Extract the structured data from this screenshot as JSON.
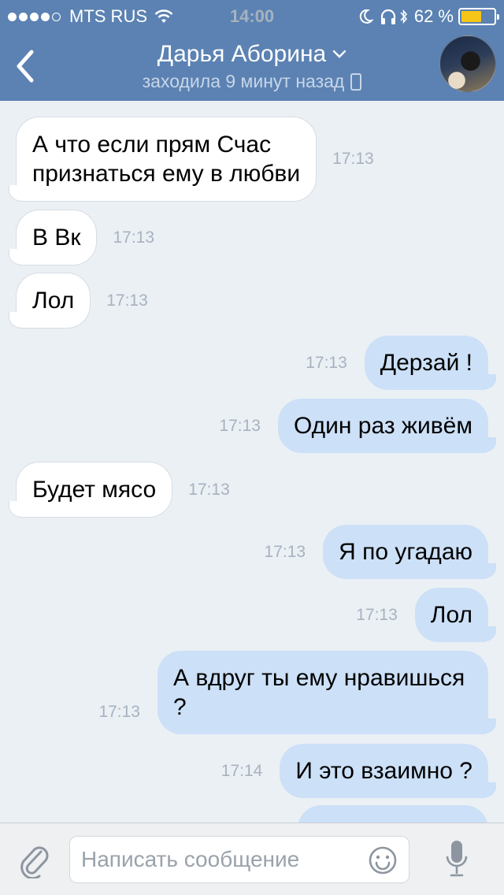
{
  "status_bar": {
    "carrier": "MTS RUS",
    "time": "14:00",
    "battery_percent": "62 %",
    "battery_level": 0.62,
    "signal_bars": 4,
    "battery_color": "#f5c518"
  },
  "header": {
    "back_icon": "chevron-left-icon",
    "contact_name": "Дарья Аборина",
    "last_seen": "заходила 9 минут назад",
    "device_icon": "phone-icon",
    "background_color": "#5b82b2"
  },
  "messages": [
    {
      "direction": "in",
      "lines": [
        "А что если прям Счас",
        "признаться ему в любви"
      ],
      "time": "17:13"
    },
    {
      "direction": "in",
      "lines": [
        "В Вк"
      ],
      "time": "17:13"
    },
    {
      "direction": "in",
      "lines": [
        "Лол"
      ],
      "time": "17:13"
    },
    {
      "direction": "out",
      "lines": [
        "Дерзай !"
      ],
      "time": "17:13"
    },
    {
      "direction": "out",
      "lines": [
        "Один раз живём"
      ],
      "time": "17:13"
    },
    {
      "direction": "in",
      "lines": [
        "Будет мясо"
      ],
      "time": "17:13"
    },
    {
      "direction": "out",
      "lines": [
        "Я по угадаю"
      ],
      "time": "17:13"
    },
    {
      "direction": "out",
      "lines": [
        "Лол"
      ],
      "time": "17:13"
    },
    {
      "direction": "out",
      "lines": [
        "А вдруг ты ему нравишься",
        "?"
      ],
      "time": "17:13"
    },
    {
      "direction": "out",
      "lines": [
        "И это взаимно ?"
      ],
      "time": "17:14"
    }
  ],
  "composer": {
    "placeholder": "Написать сообщение",
    "attach_icon": "paperclip-icon",
    "emoji_icon": "smile-icon",
    "mic_icon": "microphone-icon"
  },
  "colors": {
    "incoming_bubble": "#ffffff",
    "outgoing_bubble": "#cce0f7",
    "chat_background": "#ebf0f5",
    "timestamp": "#a7b2bf"
  }
}
